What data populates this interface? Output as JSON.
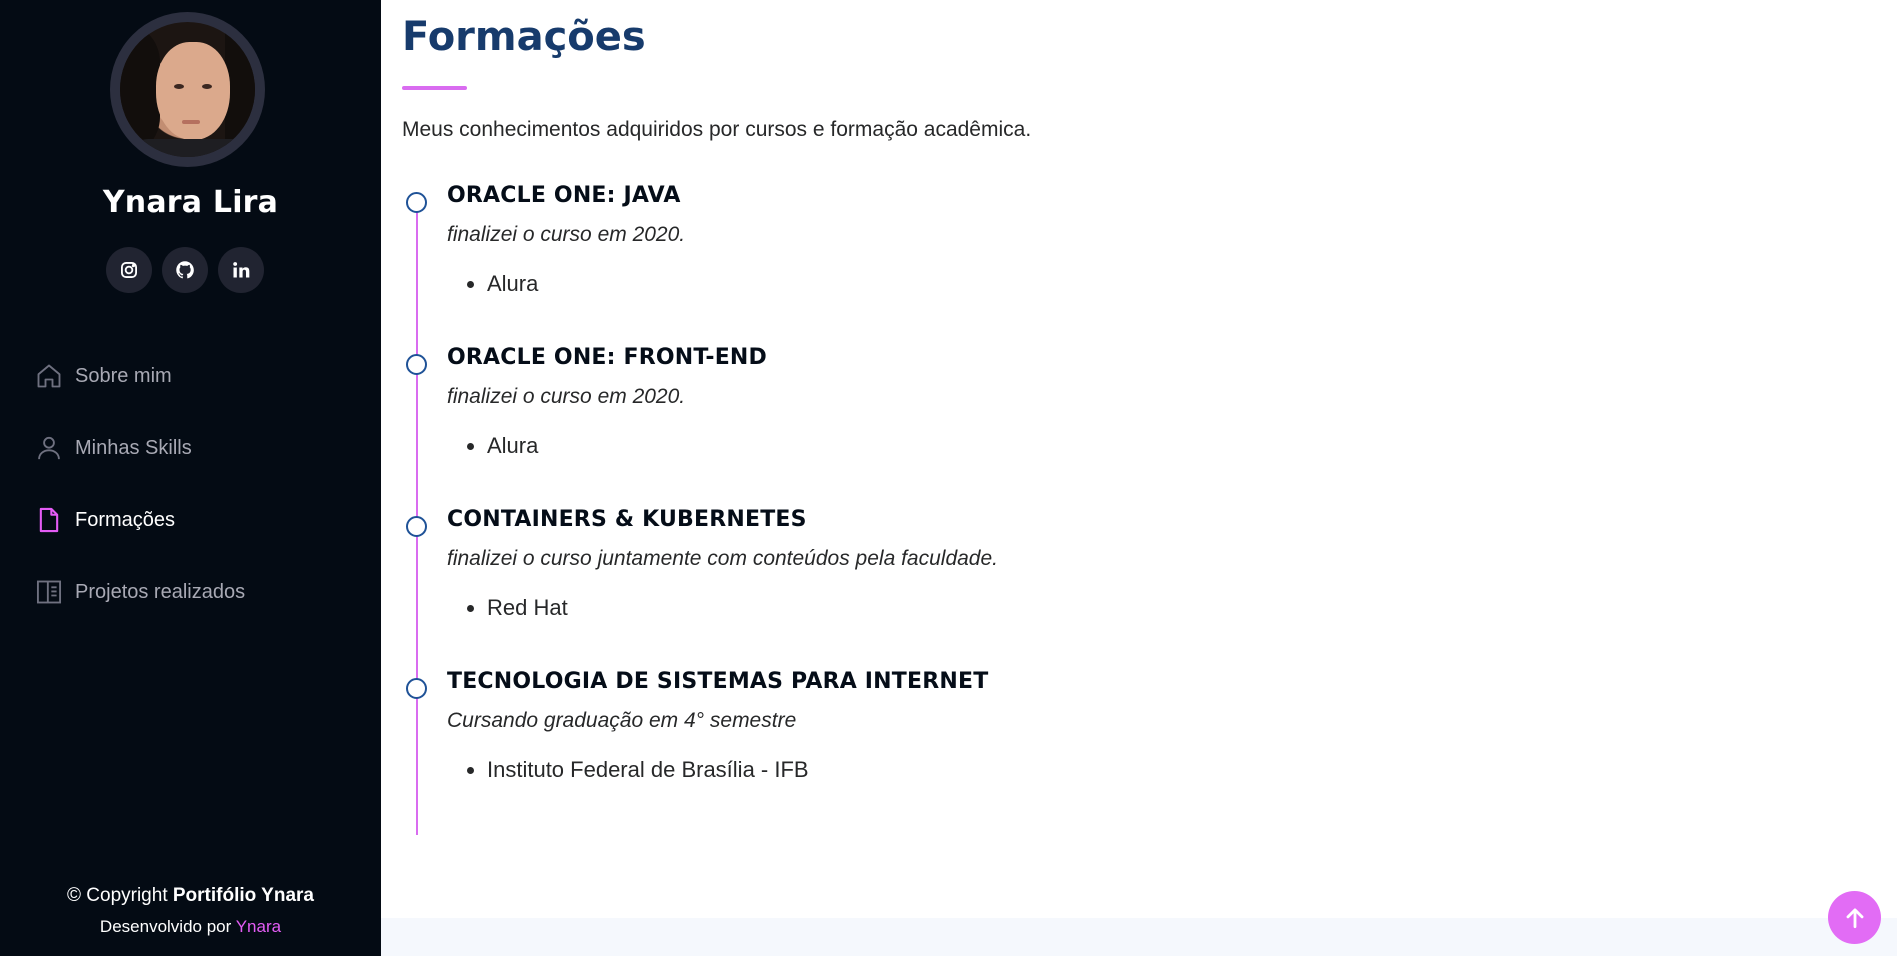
{
  "sidebar": {
    "name": "Ynara Lira",
    "socials": [
      {
        "icon": "instagram-icon"
      },
      {
        "icon": "github-icon"
      },
      {
        "icon": "linkedin-icon"
      }
    ],
    "nav": [
      {
        "label": "Sobre mim",
        "icon": "house-icon",
        "active": false
      },
      {
        "label": "Minhas Skills",
        "icon": "person-icon",
        "active": false
      },
      {
        "label": "Formações",
        "icon": "file-icon",
        "active": true
      },
      {
        "label": "Projetos realizados",
        "icon": "layout-icon",
        "active": false
      }
    ],
    "footer": {
      "copyright_prefix": "© Copyright ",
      "copyright_brand": "Portifólio Ynara",
      "developed_prefix": "Desenvolvido por ",
      "developed_name": "Ynara"
    }
  },
  "main": {
    "title": "Formações",
    "intro": "Meus conhecimentos adquiridos por cursos e formação acadêmica.",
    "items": [
      {
        "title": "ORACLE ONE: JAVA",
        "subtitle": "finalizei o curso em 2020.",
        "bullet": "Alura"
      },
      {
        "title": "ORACLE ONE: FRONT-END",
        "subtitle": "finalizei o curso em 2020.",
        "bullet": "Alura"
      },
      {
        "title": "CONTAINERS & KUBERNETES",
        "subtitle": "finalizei o curso juntamente com conteúdos pela faculdade.",
        "bullet": "Red Hat"
      },
      {
        "title": "TECNOLOGIA DE SISTEMAS PARA INTERNET",
        "subtitle": "Cursando graduação em 4° semestre",
        "bullet": "Instituto Federal de Brasília - IFB"
      }
    ]
  },
  "colors": {
    "sidebar_bg": "#040b14",
    "accent": "#e26cf5",
    "title": "#173b6c",
    "timeline_dot": "#1f5297"
  }
}
